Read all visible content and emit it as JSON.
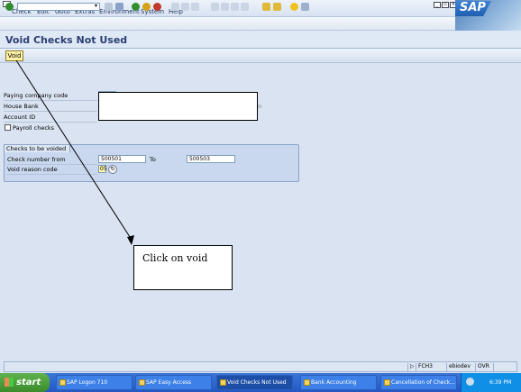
{
  "menubar": {
    "items": [
      "Check",
      "Edit",
      "Goto",
      "Extras",
      "Environment",
      "System",
      "Help"
    ]
  },
  "sap_logo": "SAP",
  "page_title": "Void Checks Not Used",
  "app_toolbar": {
    "void_label": "Void"
  },
  "form": {
    "paying_company_code_label": "Paying company code",
    "house_bank_label": "House Bank",
    "account_id_label": "Account ID",
    "payroll_checks_label": "Payroll checks",
    "payroll_checks_checked": false
  },
  "checks_group": {
    "title": "Checks to be voided",
    "check_number_from_label": "Check number from",
    "check_number_from_value": "500501",
    "to_label": "To",
    "check_number_to_value": "500503",
    "void_reason_label": "Void reason code",
    "void_reason_value": "05"
  },
  "annotation": {
    "text": "Click on void"
  },
  "statusbar": {
    "transaction": "FCH3",
    "server": "ebiodev",
    "mode": "OVR"
  },
  "taskbar": {
    "start_label": "start",
    "tasks": [
      "SAP Logon 710",
      "SAP Easy Access",
      "Void Checks Not Used",
      "Bank Accounting",
      "Cancellation of Check..."
    ],
    "clock": "6:39 PM"
  },
  "colors": {
    "title_text": "#2b3f73",
    "void_button": "#fff3a8",
    "taskbar": "#2457c4",
    "start_button": "#3b8b2c"
  }
}
